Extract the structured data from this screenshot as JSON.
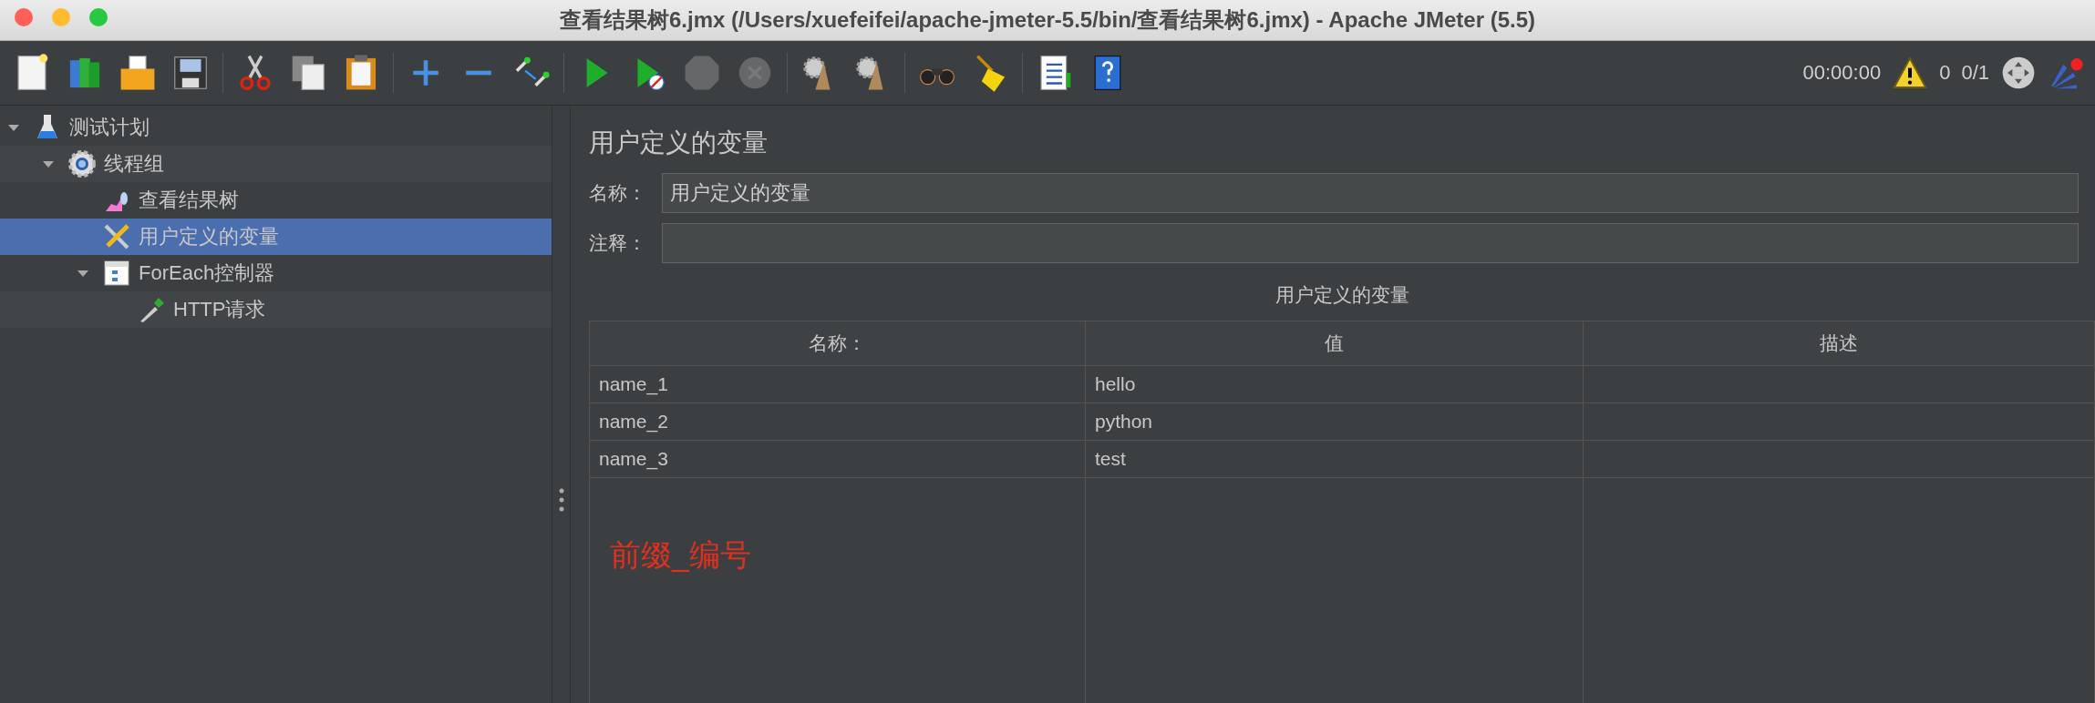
{
  "window": {
    "title": "查看结果树6.jmx (/Users/xuefeifei/apache-jmeter-5.5/bin/查看结果树6.jmx) - Apache JMeter (5.5)"
  },
  "toolbar": [
    {
      "kind": "new",
      "disabled": false
    },
    {
      "kind": "templates",
      "disabled": false
    },
    {
      "kind": "open",
      "disabled": false
    },
    {
      "kind": "save",
      "disabled": false
    },
    {
      "kind": "sep"
    },
    {
      "kind": "cut",
      "disabled": false
    },
    {
      "kind": "copy",
      "disabled": false
    },
    {
      "kind": "paste",
      "disabled": false
    },
    {
      "kind": "sep"
    },
    {
      "kind": "expand",
      "disabled": false
    },
    {
      "kind": "collapse",
      "disabled": false
    },
    {
      "kind": "toggle",
      "disabled": false
    },
    {
      "kind": "sep"
    },
    {
      "kind": "start",
      "disabled": false
    },
    {
      "kind": "start-no-pause",
      "disabled": false
    },
    {
      "kind": "stop",
      "disabled": true
    },
    {
      "kind": "shutdown",
      "disabled": true
    },
    {
      "kind": "sep"
    },
    {
      "kind": "clear",
      "disabled": false
    },
    {
      "kind": "clear-all",
      "disabled": false
    },
    {
      "kind": "sep"
    },
    {
      "kind": "search",
      "disabled": false
    },
    {
      "kind": "reset-search",
      "disabled": false
    },
    {
      "kind": "sep"
    },
    {
      "kind": "function-helper",
      "disabled": false
    },
    {
      "kind": "help",
      "disabled": false
    }
  ],
  "status": {
    "elapsed": "00:00:00",
    "warnings": "0",
    "threads": "0/1"
  },
  "tree": [
    {
      "label": "测试计划",
      "kind": "test-plan",
      "expanded": true,
      "selected": false,
      "children": [
        {
          "label": "线程组",
          "kind": "thread-group",
          "expanded": true,
          "selected": false,
          "children": [
            {
              "label": "查看结果树",
              "kind": "listener",
              "selected": false
            },
            {
              "label": "用户定义的变量",
              "kind": "config",
              "selected": true
            },
            {
              "label": "ForEach控制器",
              "kind": "controller",
              "expanded": true,
              "selected": false,
              "children": [
                {
                  "label": "HTTP请求",
                  "kind": "sampler",
                  "selected": false
                }
              ]
            }
          ]
        }
      ]
    }
  ],
  "panel": {
    "title": "用户定义的变量",
    "name_label": "名称：",
    "name_value": "用户定义的变量",
    "comment_label": "注释：",
    "table": {
      "title": "用户定义的变量",
      "columns": [
        "名称：",
        "值",
        "描述"
      ],
      "rows": [
        {
          "name": "name_1",
          "value": "hello"
        },
        {
          "name": "name_2",
          "value": "python"
        },
        {
          "name": "name_3",
          "value": "test"
        }
      ]
    },
    "annotation": "前缀_编号"
  }
}
